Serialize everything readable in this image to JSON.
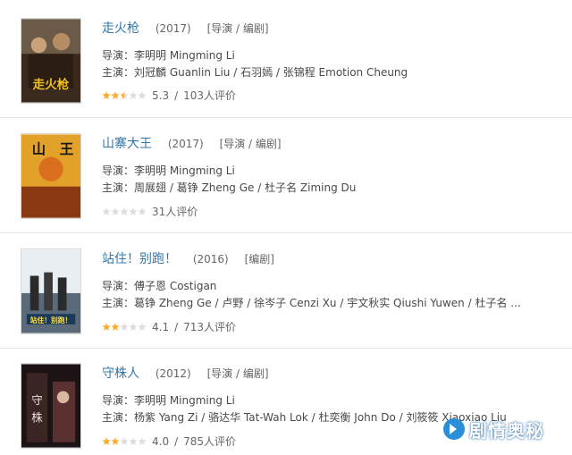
{
  "films": [
    {
      "title": "走火枪",
      "year": "(2017)",
      "roles": "[导演 / 编剧]",
      "director": "导演：李明明 Mingming Li",
      "cast": "主演：刘冠麟 Guanlin Liu / 石羽嫣 / 张锦程 Emotion Cheung",
      "rating": 0.53,
      "score": "5.3",
      "slash": "/",
      "votes": "103人评价"
    },
    {
      "title": "山寨大王",
      "year": "(2017)",
      "roles": "[导演 / 编剧]",
      "director": "导演：李明明 Mingming Li",
      "cast": "主演：周展翅 / 葛铮 Zheng Ge / 杜子名 Ziming Du",
      "rating": 0,
      "score": "",
      "slash": "",
      "votes": "31人评价"
    },
    {
      "title": "站住！别跑！",
      "year": "(2016)",
      "roles": "[编剧]",
      "director": "导演：傅子恩 Costigan",
      "cast": "主演：葛铮 Zheng Ge / 卢野 / 徐岑子 Cenzi Xu / 宇文秋实 Qiushi Yuwen / 杜子名 ...",
      "rating": 0.41,
      "score": "4.1",
      "slash": "/",
      "votes": "713人评价"
    },
    {
      "title": "守株人",
      "year": "(2012)",
      "roles": "[导演 / 编剧]",
      "director": "导演：李明明 Mingming Li",
      "cast": "主演：杨紫 Yang Zi / 骆达华 Tat-Wah Lok / 杜奕衡 John Do / 刘筱筱 Xiaoxiao Liu",
      "rating": 0.4,
      "score": "4.0",
      "slash": "/",
      "votes": "785人评价"
    }
  ],
  "watermark": {
    "text": "剧情奥秘"
  },
  "colors": {
    "link": "#3377aa",
    "star": "#ffac2d",
    "star_empty": "#dddddd"
  }
}
